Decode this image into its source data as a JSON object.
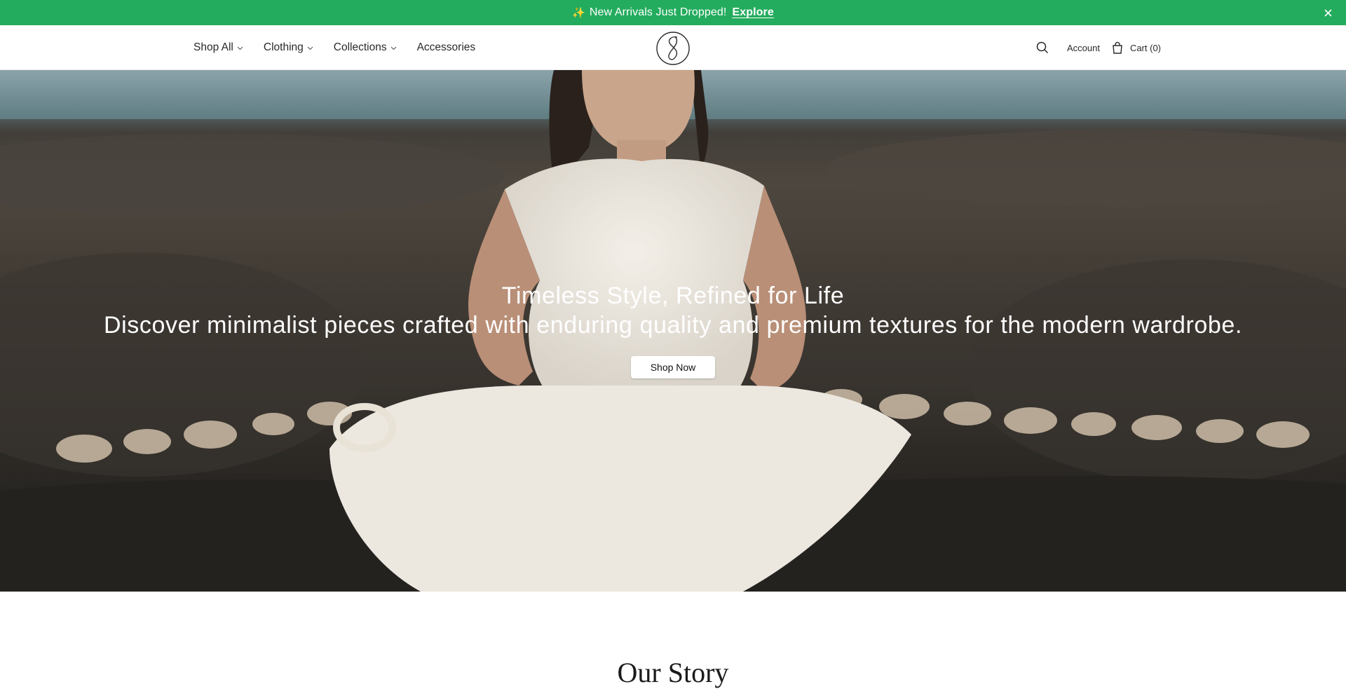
{
  "announcement": {
    "sparkle": "✨",
    "text": "New Arrivals Just Dropped!",
    "link_label": "Explore",
    "background": "#24ac5e"
  },
  "nav": {
    "items": [
      {
        "label": "Shop All",
        "has_dropdown": true
      },
      {
        "label": "Clothing",
        "has_dropdown": true
      },
      {
        "label": "Collections",
        "has_dropdown": true
      },
      {
        "label": "Accessories",
        "has_dropdown": false
      }
    ]
  },
  "header_tools": {
    "search_icon": "search-icon",
    "account_label": "Account",
    "cart_label": "Cart (0)"
  },
  "hero": {
    "title": "Timeless Style, Refined for Life",
    "subtitle": "Discover minimalist pieces crafted with enduring quality and premium textures for the modern wardrobe.",
    "cta_label": "Shop Now"
  },
  "story": {
    "title": "Our Story"
  }
}
